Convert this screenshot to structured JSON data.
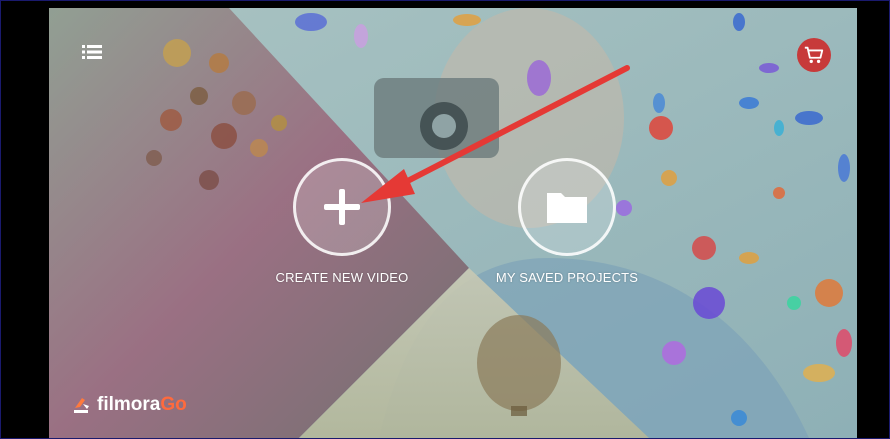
{
  "app": {
    "logo_main": "filmora",
    "logo_accent": "Go"
  },
  "header": {
    "menu_icon": "list-menu-icon",
    "cart_icon": "shopping-cart-icon"
  },
  "actions": {
    "create_label": "CREATE NEW VIDEO",
    "create_icon": "plus-icon",
    "saved_label": "MY SAVED PROJECTS",
    "saved_icon": "folder-icon"
  },
  "annotation": {
    "arrow_color": "#e53935"
  },
  "colors": {
    "cart_bg": "#c73a3a",
    "logo_accent": "#ff6a3d"
  }
}
